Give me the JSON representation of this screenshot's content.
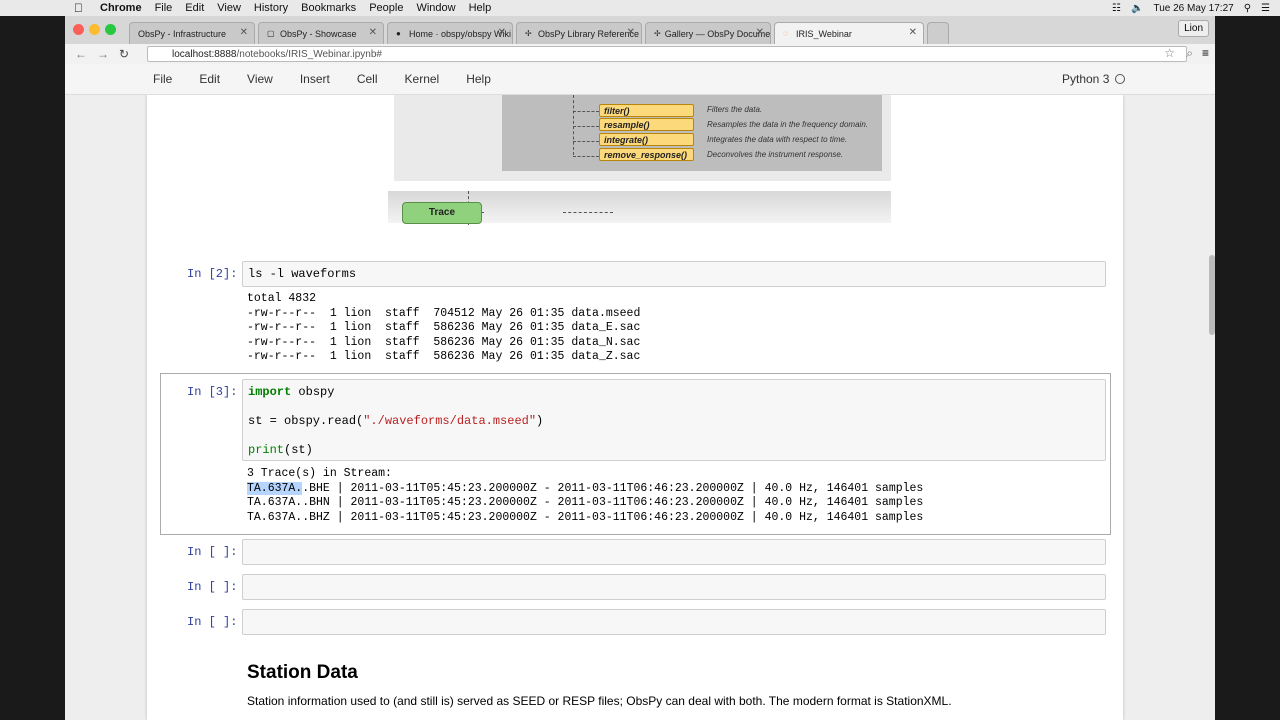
{
  "menubar": {
    "app": "Chrome",
    "items": [
      "File",
      "Edit",
      "View",
      "History",
      "Bookmarks",
      "People",
      "Window",
      "Help"
    ],
    "clock": "Tue 26 May 17:27",
    "user": "Lion"
  },
  "browser": {
    "tabs": [
      {
        "label": "ObsPy - Infrastructure"
      },
      {
        "label": "ObsPy - Showcase"
      },
      {
        "label": "Home · obspy/obspy Wiki"
      },
      {
        "label": "ObsPy Library Reference"
      },
      {
        "label": "Gallery — ObsPy Documen"
      },
      {
        "label": "IRIS_Webinar"
      }
    ],
    "url_host": "localhost:8888",
    "url_path": "/notebooks/IRIS_Webinar.ipynb#"
  },
  "jupyter": {
    "menu": [
      "File",
      "Edit",
      "View",
      "Insert",
      "Cell",
      "Kernel",
      "Help"
    ],
    "kernel": "Python 3"
  },
  "diagram": {
    "methods": [
      {
        "name": "filter()",
        "desc": "Filters the data."
      },
      {
        "name": "resample()",
        "desc": "Resamples the data in the frequency domain."
      },
      {
        "name": "integrate()",
        "desc": "Integrates the data with respect to time."
      },
      {
        "name": "remove_response()",
        "desc": "Deconvolves the instrument response."
      }
    ],
    "trace_label": "Trace"
  },
  "cells": {
    "c2": {
      "prompt": "In [2]:",
      "code": "ls -l waveforms",
      "output": [
        "total 4832",
        "-rw-r--r--  1 lion  staff  704512 May 26 01:35 data.mseed",
        "-rw-r--r--  1 lion  staff  586236 May 26 01:35 data_E.sac",
        "-rw-r--r--  1 lion  staff  586236 May 26 01:35 data_N.sac",
        "-rw-r--r--  1 lion  staff  586236 May 26 01:35 data_Z.sac"
      ]
    },
    "c3": {
      "prompt": "In [3]:",
      "line1_kw": "import",
      "line1_rest": " obspy",
      "line2_pre": "st = obspy.read(",
      "line2_str": "\"./waveforms/data.mseed\"",
      "line2_post": ")",
      "line3_fn": "print",
      "line3_rest": "(st)",
      "out_header": "3 Trace(s) in Stream:",
      "out_sel": "TA.637A.",
      "out_line1_rest": ".BHE | 2011-03-11T05:45:23.200000Z - 2011-03-11T06:46:23.200000Z | 40.0 Hz, 146401 samples",
      "out_line2": "TA.637A..BHN | 2011-03-11T05:45:23.200000Z - 2011-03-11T06:46:23.200000Z | 40.0 Hz, 146401 samples",
      "out_line3": "TA.637A..BHZ | 2011-03-11T05:45:23.200000Z - 2011-03-11T06:46:23.200000Z | 40.0 Hz, 146401 samples"
    },
    "empty_prompt": "In [ ]:"
  },
  "markdown": {
    "heading": "Station Data",
    "text": "Station information used to (and still is) served as SEED or RESP files; ObsPy can deal with both. The modern format is StationXML."
  }
}
